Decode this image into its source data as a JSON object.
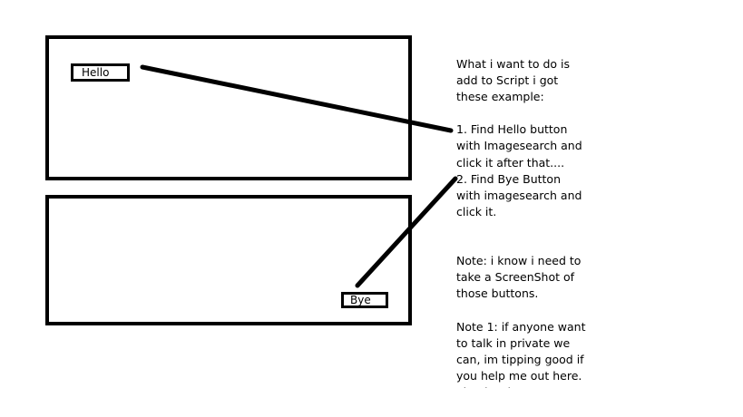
{
  "diagram": {
    "hello_button_label": "Hello",
    "bye_button_label": "Bye"
  },
  "note": {
    "text": "What i want to do is\nadd to Script i got\nthese example:\n\n1. Find Hello button\nwith Imagesearch and\nclick it after that....\n2. Find Bye Button\nwith imagesearch and\nclick it.\n\n\nNote: i know i need to\ntake a ScreenShot of\nthose buttons.\n\nNote 1: if anyone want\nto talk in private we\ncan, im tipping good if\nyou help me out here.\nThanks alot."
  },
  "colors": {
    "ink": "#000000",
    "background": "#ffffff"
  }
}
